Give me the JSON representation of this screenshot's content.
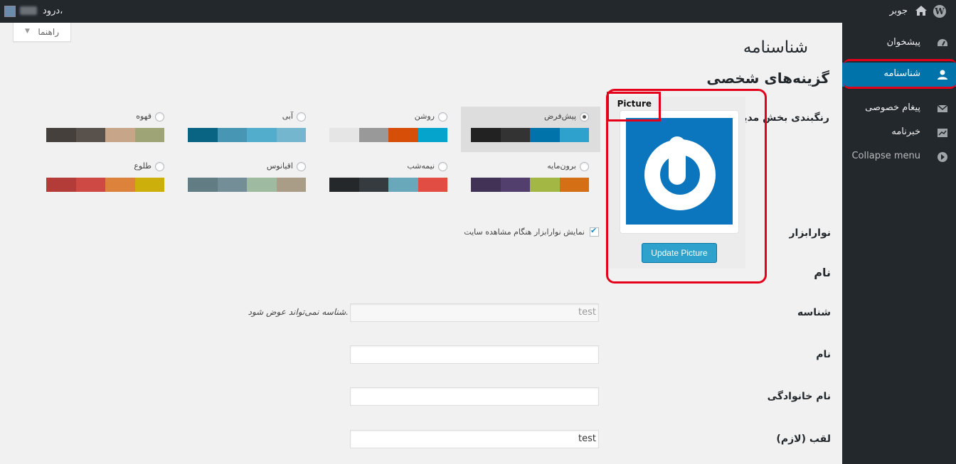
{
  "adminbar": {
    "site_name": "جوبر",
    "greeting": "درود،",
    "wp_logo": "W",
    "home_icon": "home-icon"
  },
  "sidebar": {
    "items": [
      {
        "label": "پیشخوان",
        "icon": "dashboard-icon"
      },
      {
        "label": "شناسنامه",
        "icon": "user-icon"
      },
      {
        "label": "پیغام خصوصی",
        "icon": "mail-icon"
      },
      {
        "label": "خبرنامه",
        "icon": "newsletter-icon"
      },
      {
        "label": "Collapse menu",
        "icon": "collapse-icon"
      }
    ],
    "active_color": "#0073aa"
  },
  "help_tab": {
    "label": "راهنما",
    "arrow": "▼"
  },
  "page_title": "شناسنامه",
  "section_title": "گزینه‌های شخصی",
  "labels": {
    "color_scheme": "رنگبندی بخش مدیریت",
    "toolbar": "نوارابزار",
    "name_section": "نام",
    "username": "شناسه",
    "first_name": "نام",
    "last_name": "نام خانوادگی",
    "nickname": "لقب (لازم)"
  },
  "color_schemes": [
    {
      "name": "پیش‌فرض",
      "selected": true,
      "colors": [
        "#222222",
        "#333333",
        "#0073aa",
        "#2ea2cc"
      ]
    },
    {
      "name": "روشن",
      "selected": false,
      "colors": [
        "#e5e5e5",
        "#999999",
        "#d64e07",
        "#04a4cc"
      ]
    },
    {
      "name": "آبی",
      "selected": false,
      "colors": [
        "#096484",
        "#4796b3",
        "#52accc",
        "#74b6ce"
      ]
    },
    {
      "name": "قهوه",
      "selected": false,
      "colors": [
        "#46403c",
        "#59524c",
        "#c7a589",
        "#9ea476"
      ]
    },
    {
      "name": "برون‌مایه",
      "selected": false,
      "colors": [
        "#413256",
        "#523f6d",
        "#a3b745",
        "#d46f15"
      ]
    },
    {
      "name": "نیمه‌شب",
      "selected": false,
      "colors": [
        "#25282b",
        "#363b3f",
        "#69a8bb",
        "#e14d43"
      ]
    },
    {
      "name": "اقیانوس",
      "selected": false,
      "colors": [
        "#627c83",
        "#738e96",
        "#9ebaa0",
        "#aa9d88"
      ]
    },
    {
      "name": "طلوع",
      "selected": false,
      "colors": [
        "#b43c38",
        "#cf4944",
        "#dd823b",
        "#ccaf0b"
      ]
    }
  ],
  "toolbar_option": {
    "label": "نمایش نوارابزار هنگام مشاهده سایت",
    "checked": true
  },
  "picture": {
    "title": "Picture",
    "button": "Update Picture"
  },
  "fields": {
    "username_value": "test",
    "username_note": "شناسه نمی‌تواند عوض شود.",
    "first_name_value": "",
    "last_name_value": "",
    "nickname_value": "test"
  }
}
